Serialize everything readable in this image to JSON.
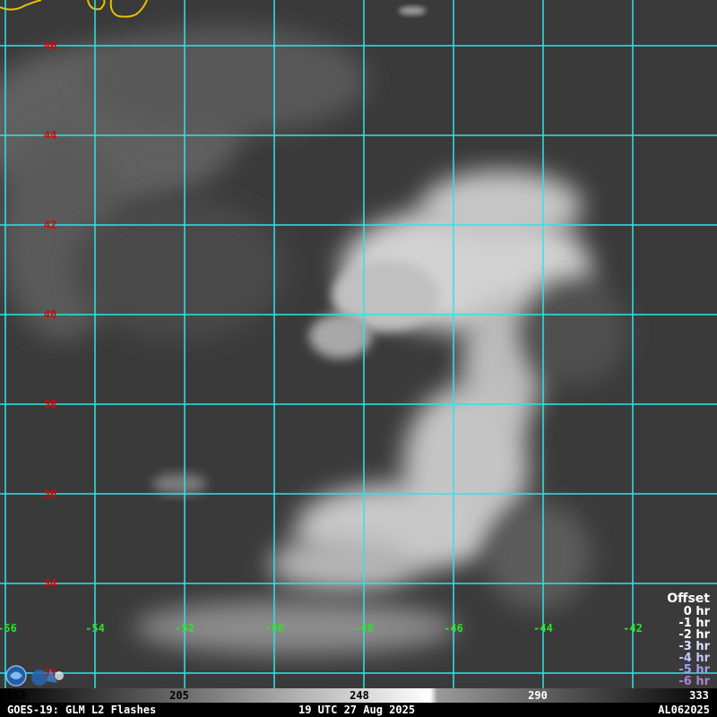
{
  "map": {
    "lat_labels": [
      "46",
      "44",
      "42",
      "40",
      "38",
      "36",
      "34",
      "32"
    ],
    "lon_labels": [
      "-56",
      "-54",
      "-52",
      "-50",
      "-48",
      "-46",
      "-44",
      "-42"
    ],
    "grid_color": "#2ce6e6",
    "coastline_color": "#e8c200"
  },
  "legend": {
    "title": "Offset",
    "items": [
      {
        "label": "0 hr",
        "color": "#ffffff"
      },
      {
        "label": "-1 hr",
        "color": "#ffffff"
      },
      {
        "label": "-2 hr",
        "color": "#ffffff"
      },
      {
        "label": "-3 hr",
        "color": "#e0e0ff"
      },
      {
        "label": "-4 hr",
        "color": "#c0c8ff"
      },
      {
        "label": "-5 hr",
        "color": "#a0a0ee"
      },
      {
        "label": "-6 hr",
        "color": "#b080d0"
      }
    ]
  },
  "colorbar": {
    "ticks": [
      "163",
      "205",
      "248",
      "290",
      "333"
    ]
  },
  "status": {
    "left": "GOES-19: GLM L2 Flashes",
    "center": "19 UTC 27 Aug 2025",
    "right": "AL062025"
  }
}
